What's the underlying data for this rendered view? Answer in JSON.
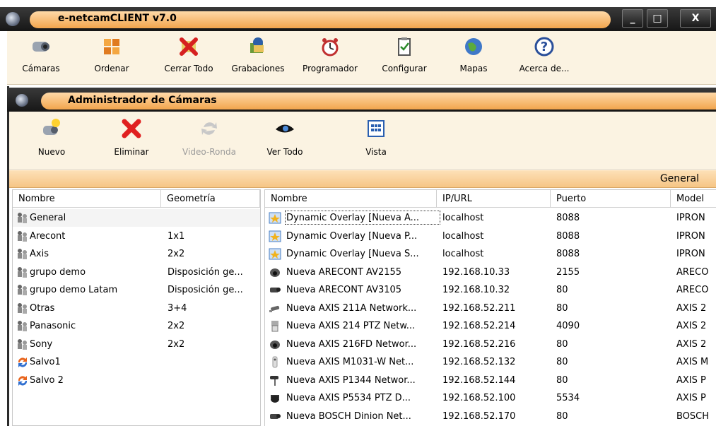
{
  "window": {
    "title": "e-netcamCLIENT v7.0",
    "min_glyph": "_",
    "max_glyph": "□",
    "close_glyph": "X"
  },
  "main_toolbar": [
    {
      "label": "Cámaras",
      "icon": "camera-icon"
    },
    {
      "label": "Ordenar",
      "icon": "grid-arrange-icon"
    },
    {
      "label": "Cerrar Todo",
      "icon": "close-all-icon"
    },
    {
      "label": "Grabaciones",
      "icon": "recordings-icon"
    },
    {
      "label": "Programador",
      "icon": "alarm-clock-icon"
    },
    {
      "label": "Configurar",
      "icon": "config-clipboard-icon"
    },
    {
      "label": "Mapas",
      "icon": "globe-icon"
    },
    {
      "label": "Acerca de...",
      "icon": "help-icon"
    }
  ],
  "admin": {
    "title": "Administrador de Cámaras",
    "toolbar": [
      {
        "label": "Nuevo",
        "icon": "new-camera-icon",
        "disabled": false
      },
      {
        "label": "Eliminar",
        "icon": "delete-x-icon",
        "disabled": false
      },
      {
        "label": "Video-Ronda",
        "icon": "video-round-icon",
        "disabled": true
      },
      {
        "label": "Ver Todo",
        "icon": "eye-icon",
        "disabled": false
      },
      {
        "label": "Vista",
        "icon": "view-grid-icon",
        "disabled": false
      }
    ],
    "group_label": "General"
  },
  "groups": {
    "columns": [
      "Nombre",
      "Geometría"
    ],
    "rows": [
      {
        "name": "General",
        "geometry": "",
        "icon": "group-icon"
      },
      {
        "name": "Arecont",
        "geometry": "1x1",
        "icon": "group-icon"
      },
      {
        "name": "Axis",
        "geometry": "2x2",
        "icon": "group-icon"
      },
      {
        "name": "grupo demo",
        "geometry": "Disposición ge...",
        "icon": "group-icon"
      },
      {
        "name": "grupo demo Latam",
        "geometry": "Disposición ge...",
        "icon": "group-icon"
      },
      {
        "name": "Otras",
        "geometry": "3+4",
        "icon": "group-icon"
      },
      {
        "name": "Panasonic",
        "geometry": "2x2",
        "icon": "group-icon"
      },
      {
        "name": "Sony",
        "geometry": "2x2",
        "icon": "group-icon"
      },
      {
        "name": "Salvo1",
        "geometry": "",
        "icon": "salvo-icon"
      },
      {
        "name": "Salvo 2",
        "geometry": "",
        "icon": "salvo-icon"
      }
    ]
  },
  "cameras": {
    "columns": [
      "Nombre",
      "IP/URL",
      "Puerto",
      "Model"
    ],
    "rows": [
      {
        "name": "Dynamic Overlay [Nueva A...",
        "ip": "localhost",
        "port": "8088",
        "model": "IPRON",
        "icon": "overlay-icon"
      },
      {
        "name": "Dynamic Overlay [Nueva P...",
        "ip": "localhost",
        "port": "8088",
        "model": "IPRON",
        "icon": "overlay-icon"
      },
      {
        "name": "Dynamic Overlay [Nueva S...",
        "ip": "localhost",
        "port": "8088",
        "model": "IPRON",
        "icon": "overlay-icon"
      },
      {
        "name": "Nueva ARECONT AV2155",
        "ip": "192.168.10.33",
        "port": "2155",
        "model": "ARECO",
        "icon": "dome-camera-icon"
      },
      {
        "name": "Nueva ARECONT AV3105",
        "ip": "192.168.10.32",
        "port": "80",
        "model": "ARECO",
        "icon": "box-camera-icon"
      },
      {
        "name": "Nueva AXIS 211A Network...",
        "ip": "192.168.52.211",
        "port": "80",
        "model": "AXIS 2",
        "icon": "bullet-camera-icon"
      },
      {
        "name": "Nueva AXIS 214 PTZ Netw...",
        "ip": "192.168.52.214",
        "port": "4090",
        "model": "AXIS 2",
        "icon": "ptz-camera-icon"
      },
      {
        "name": "Nueva AXIS 216FD Networ...",
        "ip": "192.168.52.216",
        "port": "80",
        "model": "AXIS 2",
        "icon": "dome-camera-icon"
      },
      {
        "name": "Nueva AXIS M1031-W Net...",
        "ip": "192.168.52.132",
        "port": "80",
        "model": "AXIS M",
        "icon": "cube-camera-icon"
      },
      {
        "name": "Nueva AXIS P1344 Networ...",
        "ip": "192.168.52.144",
        "port": "80",
        "model": "AXIS P",
        "icon": "mount-camera-icon"
      },
      {
        "name": "Nueva AXIS P5534 PTZ D...",
        "ip": "192.168.52.100",
        "port": "5534",
        "model": "AXIS P",
        "icon": "ptz-dome-icon"
      },
      {
        "name": "Nueva BOSCH Dinion Net...",
        "ip": "192.168.52.170",
        "port": "80",
        "model": "BOSCH",
        "icon": "box-camera-icon"
      }
    ]
  }
}
